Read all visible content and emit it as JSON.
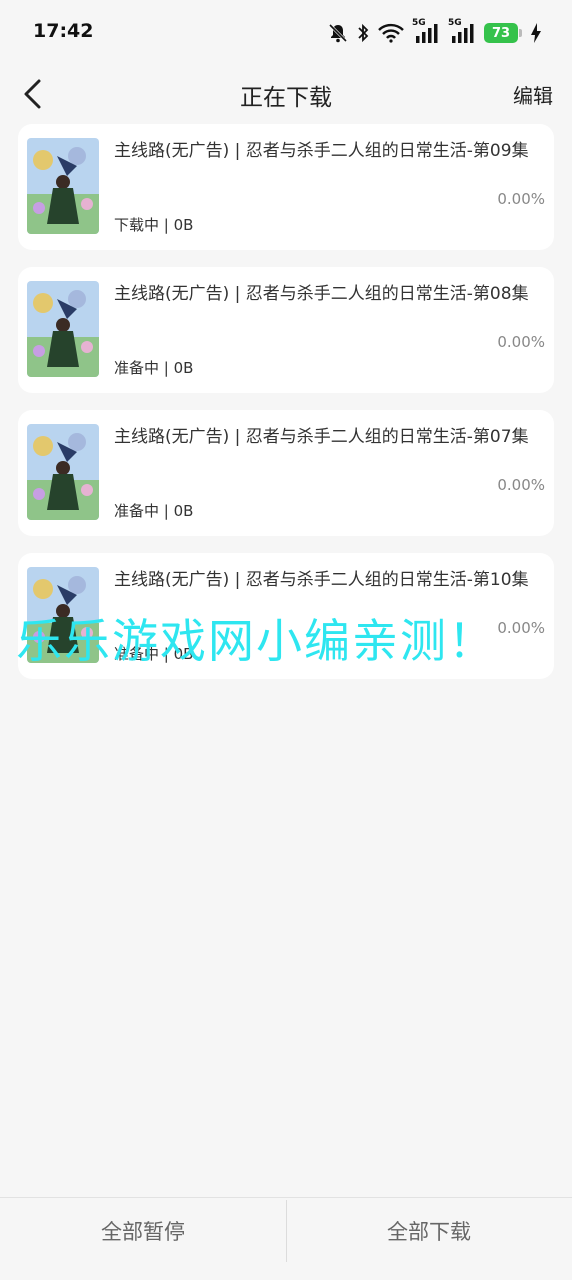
{
  "status_bar": {
    "time": "17:42",
    "signal1_label": "5G",
    "signal2_label": "5G",
    "battery": "73",
    "icons": [
      "mute-bell-icon",
      "bluetooth-icon",
      "wifi-icon",
      "signal-icon",
      "signal-icon",
      "battery-icon",
      "charging-icon"
    ]
  },
  "nav": {
    "back_icon": "chevron-left-icon",
    "title": "正在下载",
    "edit_label": "编辑"
  },
  "downloads": [
    {
      "title": "主线路(无广告) | 忍者与杀手二人组的日常生活-第09集",
      "percent": "0.00%",
      "status": "下载中 | 0B"
    },
    {
      "title": "主线路(无广告) | 忍者与杀手二人组的日常生活-第08集",
      "percent": "0.00%",
      "status": "准备中 | 0B"
    },
    {
      "title": "主线路(无广告) | 忍者与杀手二人组的日常生活-第07集",
      "percent": "0.00%",
      "status": "准备中 | 0B"
    },
    {
      "title": "主线路(无广告) | 忍者与杀手二人组的日常生活-第10集",
      "percent": "0.00%",
      "status": "准备中 | 0B"
    }
  ],
  "watermark": "乐乐游戏网小编亲测！",
  "bottom_bar": {
    "pause_all": "全部暂停",
    "download_all": "全部下载"
  },
  "colors": {
    "background": "#f6f6f6",
    "card": "#ffffff",
    "battery": "#35c24b",
    "watermark": "#2ee6f0"
  }
}
